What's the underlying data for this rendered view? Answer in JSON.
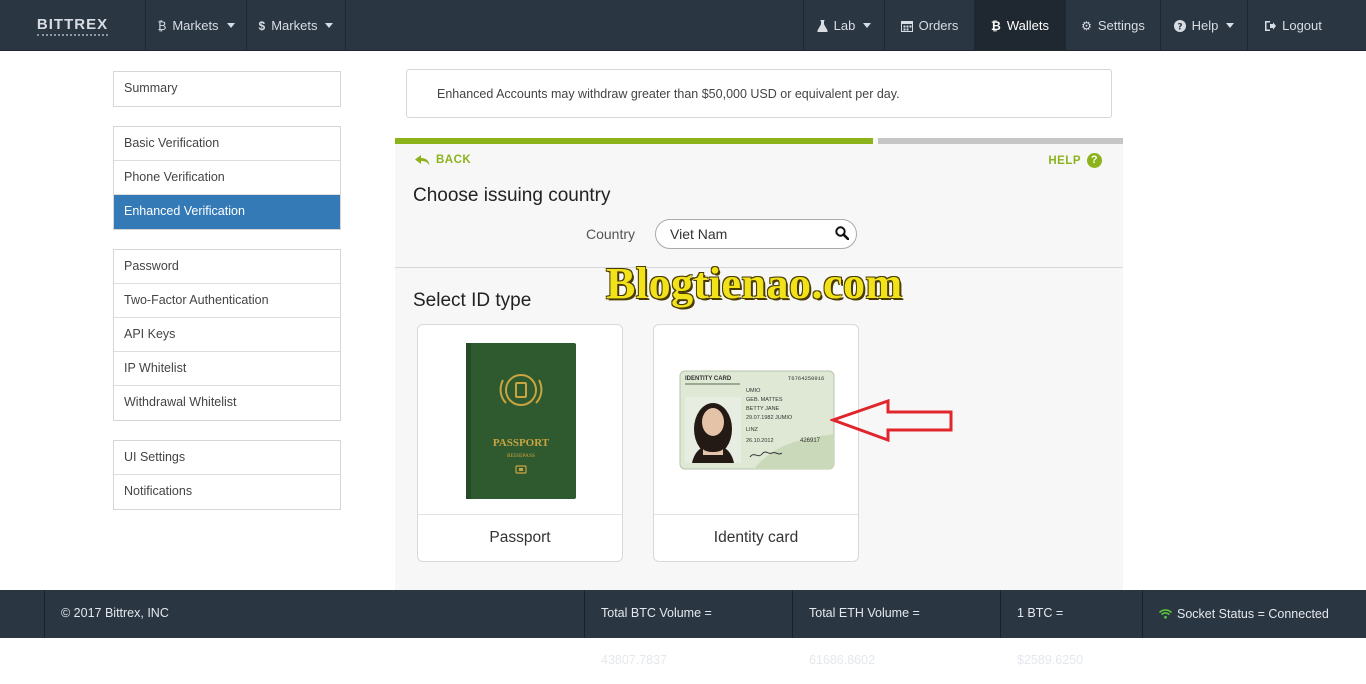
{
  "app": {
    "brand": "BITTREX"
  },
  "nav": {
    "markets_btc": "Markets",
    "markets_usd": "Markets",
    "lab": "Lab",
    "orders": "Orders",
    "wallets": "Wallets",
    "settings": "Settings",
    "help": "Help",
    "logout": "Logout"
  },
  "sidebar": {
    "groups": [
      {
        "items": [
          {
            "label": "Summary"
          }
        ]
      },
      {
        "items": [
          {
            "label": "Basic Verification"
          },
          {
            "label": "Phone Verification"
          },
          {
            "label": "Enhanced Verification",
            "active": true
          }
        ]
      },
      {
        "items": [
          {
            "label": "Password"
          },
          {
            "label": "Two-Factor Authentication"
          },
          {
            "label": "API Keys"
          },
          {
            "label": "IP Whitelist"
          },
          {
            "label": "Withdrawal Whitelist"
          }
        ]
      },
      {
        "items": [
          {
            "label": "UI Settings"
          },
          {
            "label": "Notifications"
          }
        ]
      }
    ]
  },
  "notice": {
    "text": "Enhanced Accounts may withdraw greater than $50,000 USD or equivalent per day."
  },
  "verification": {
    "back": "BACK",
    "help": "HELP",
    "title": "Choose issuing country",
    "country_label": "Country",
    "country_value": "Viet Nam",
    "id_title": "Select ID type",
    "passport": {
      "label": "Passport",
      "cover_title": "PASSPORT",
      "cover_sub": "REISEPASS"
    },
    "identity_card": {
      "label": "Identity card",
      "card_title": "IDENTITY CARD",
      "card_number": "T6764250916",
      "lines": [
        "UMIO",
        "GEB. MATTES",
        "BETTY JANE",
        "29.07.1982 JUMIO",
        "LINZ",
        "26.10.2012"
      ],
      "code": "426917"
    }
  },
  "watermark": "Blogtienao.com",
  "footer": {
    "copyright": "© 2017 Bittrex, INC",
    "btc_volume": "Total BTC Volume = 43807.7837",
    "eth_volume": "Total ETH Volume = 61686.8602",
    "btc_price": "1 BTC = $2589.6250",
    "socket": "Socket Status = Connected"
  },
  "colors": {
    "navbar": "#2b3643",
    "accent_green": "#8db31c",
    "active_blue": "#337ab7",
    "arrow_red": "#e0252c"
  },
  "icons": {
    "btc": "bitcoin-icon",
    "usd": "dollar-icon",
    "lab": "flask-icon",
    "orders": "calendar-icon",
    "settings": "gear-icon",
    "help": "question-circle-icon",
    "logout": "sign-out-icon",
    "search": "search-icon",
    "socket": "wifi-icon"
  }
}
